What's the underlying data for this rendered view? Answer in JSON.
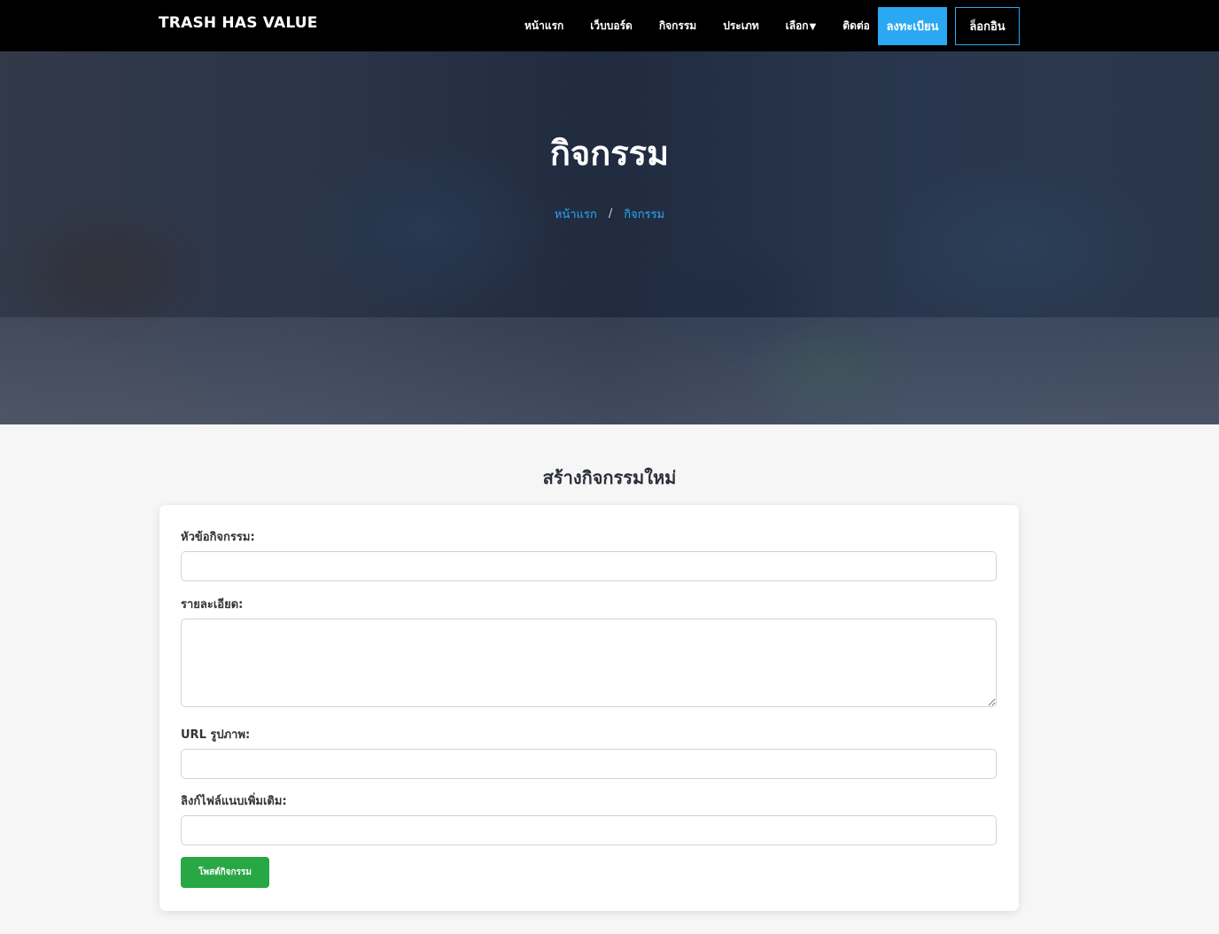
{
  "nav": {
    "brand": "TRASH HAS VALUE",
    "links": [
      "หน้าแรก",
      "เว็บบอร์ด",
      "กิจกรรม",
      "ประเภท",
      "เลือก",
      "ติดต่อ"
    ],
    "dropdown_caret": "▼",
    "register_label": "ลงทะเบียน",
    "login_label": "ล็อกอิน"
  },
  "hero": {
    "title": "กิจกรรม",
    "breadcrumb": [
      "หน้าแรก",
      "กิจกรรม"
    ],
    "separator": "/"
  },
  "form": {
    "heading": "สร้างกิจกรรมใหม่",
    "title_label": "หัวข้อกิจกรรม:",
    "title_value": "",
    "detail_label": "รายละเอียด:",
    "detail_value": "",
    "image_label": "URL รูปภาพ:",
    "image_value": "",
    "attach_label": "ลิงก์ไฟล์แนบเพิ่มเติม:",
    "attach_value": "",
    "submit_label": "โพสต์กิจกรรม"
  },
  "colors": {
    "accent": "#2aa8f2",
    "submit": "#28a745",
    "navbar": "#000000"
  }
}
